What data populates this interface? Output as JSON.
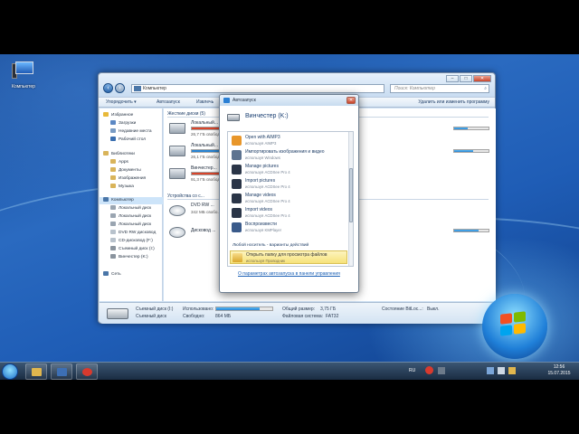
{
  "desktop": {
    "icon_label": "Компьютер"
  },
  "explorer": {
    "address": "Компьютер",
    "search_placeholder": "Поиск: Компьютер",
    "window_buttons": {
      "minimize": "–",
      "maximize": "□",
      "close": "✕"
    },
    "toolbar": {
      "organize": "Упорядочить ▾",
      "autoplay": "Автозапуск",
      "eject": "Извлечь",
      "uninstall": "Удалить или изменить программу"
    },
    "sidebar": {
      "favorites": "Избранное",
      "fav_items": [
        "Загрузки",
        "Недавние места",
        "Рабочий стол"
      ],
      "libraries": "Библиотеки",
      "lib_items": [
        "Apps",
        "Документы",
        "Изображения",
        "Музыка"
      ],
      "computer": "Компьютер",
      "comp_items": [
        "Локальный диск",
        "Локальный диск",
        "Локальный диск",
        "DVD RW дисковод",
        "CD-дисковод (F:)",
        "Съемный диск (I:)",
        "Винчестер (K:)"
      ],
      "network": "Сеть"
    },
    "main": {
      "hdd_group": "Жесткие диски (5)",
      "drives": [
        {
          "name": "Локальный...",
          "free": "26,7 ГБ свободно из ...",
          "fill_pct": 0.85,
          "color": "#d9452b"
        },
        {
          "name": "Локальный...",
          "free": "26,1 ГБ свободно",
          "fill_pct": 0.6,
          "color": "#2784d4"
        },
        {
          "name": "Винчестер...",
          "free": "91,3 ГБ свободно",
          "fill_pct": 0.7,
          "color": "#d9452b"
        }
      ],
      "removable_group": "Устройства со с...",
      "dvd": {
        "name": "DVD RW ...",
        "free": "342 МБ свобо..."
      },
      "drive_d": {
        "name": "Дисковод ..."
      }
    },
    "details": {
      "name": "Съемный диск (I:)",
      "type": "Съемный диск",
      "used_label": "Использовано:",
      "free_label": "Свободно:",
      "free_value": "864 МБ",
      "used_fill": 0.78,
      "total_label": "Общий размер:",
      "total_value": "3,75 ГБ",
      "fs_label": "Файловая система:",
      "fs_value": "FAT32",
      "bitlocker_label": "Состояние BitLoc...:",
      "bitlocker_value": "Выкл."
    }
  },
  "autoplay": {
    "title": "Автозапуск",
    "close": "✕",
    "drive_name": "Винчестер (K:)",
    "items": [
      {
        "title": "Open with AIMP3",
        "sub": "используя AIMP3",
        "icon": "aimp-icon",
        "color": "#e8962a"
      },
      {
        "title": "Импортировать изображения и видео",
        "sub": "используя Windows",
        "icon": "camera-icon",
        "color": "#5d7390"
      },
      {
        "title": "Manage pictures",
        "sub": "используя ACDSee Pro 4",
        "icon": "acdsee-icon",
        "color": "#2a3547"
      },
      {
        "title": "Import pictures",
        "sub": "используя ACDSee Pro 4",
        "icon": "acdsee-icon",
        "color": "#2a3547"
      },
      {
        "title": "Manage videos",
        "sub": "используя ACDSee Pro 4",
        "icon": "acdsee-icon",
        "color": "#2a3547"
      },
      {
        "title": "Import videos",
        "sub": "используя ACDSee Pro 4",
        "icon": "acdsee-icon",
        "color": "#2a3547"
      },
      {
        "title": "Воспроизвести",
        "sub": "используя KMPlayer",
        "icon": "kmplayer-icon",
        "color": "#3a5a8a"
      }
    ],
    "section_label": "Любой носитель - варианты действий",
    "highlight": {
      "title": "Открыть папку для просмотра файлов",
      "sub": "используя Проводник"
    },
    "settings_link": "О параметрах автозапуска в панели управления"
  },
  "taskbar": {
    "lang": "RU",
    "time": "12:56",
    "date": "15.07.2015"
  }
}
